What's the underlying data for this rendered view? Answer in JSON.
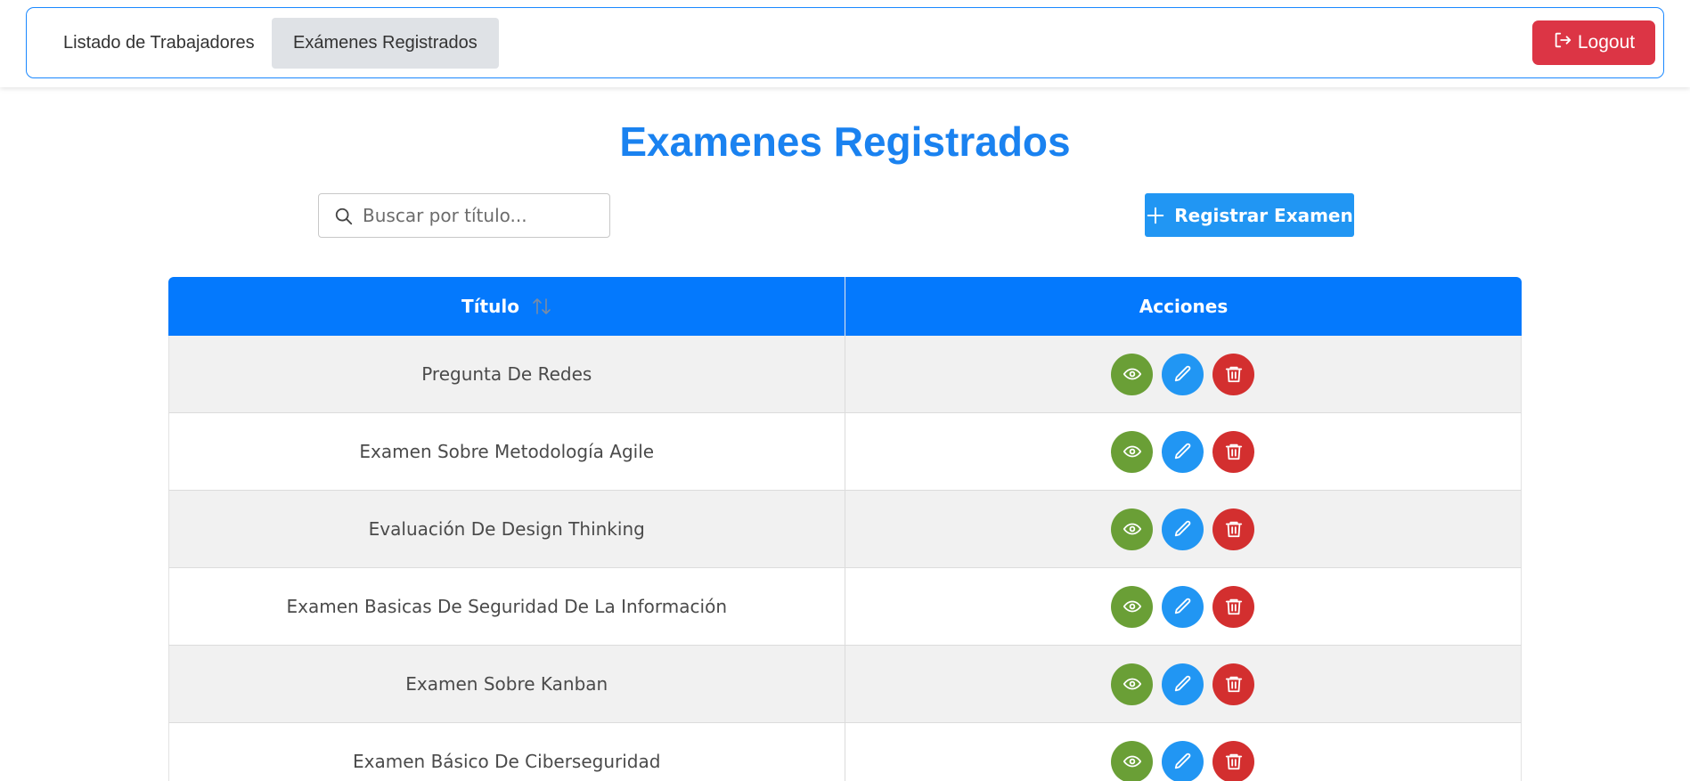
{
  "nav": {
    "items": [
      {
        "label": "Listado de Trabajadores",
        "active": false
      },
      {
        "label": "Exámenes Registrados",
        "active": true
      }
    ],
    "logout_label": "Logout",
    "logout_icon": "logout-icon"
  },
  "page": {
    "title": "Examenes Registrados"
  },
  "search": {
    "placeholder": "Buscar por título...",
    "value": "",
    "icon": "search-icon"
  },
  "register": {
    "label": "Registrar Examen",
    "icon": "plus-icon"
  },
  "table": {
    "headers": {
      "title": "Título",
      "actions": "Acciones"
    },
    "sort_icon": "sort-icon",
    "rows": [
      {
        "title": "Pregunta De Redes"
      },
      {
        "title": "Examen Sobre Metodología Agile"
      },
      {
        "title": "Evaluación De Design Thinking"
      },
      {
        "title": "Examen Basicas De Seguridad De La Información"
      },
      {
        "title": "Examen Sobre Kanban"
      },
      {
        "title": "Examen Básico De Ciberseguridad"
      }
    ],
    "actions": [
      "eye-icon",
      "pencil-icon",
      "trash-icon"
    ]
  },
  "colors": {
    "accent": "#0479fd",
    "title": "#1a82f0",
    "logout": "#dc3545",
    "view": "#6a9f36",
    "edit": "#2196f3",
    "delete": "#d32f2f"
  }
}
